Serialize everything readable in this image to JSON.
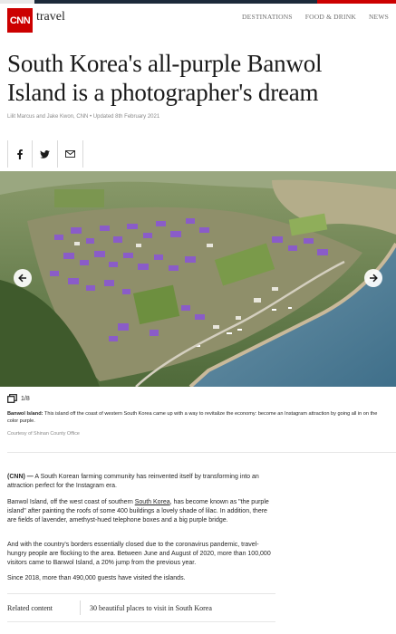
{
  "brand": {
    "logo_text": "CNN",
    "section": "travel",
    "colors": {
      "accent": "#cc0000",
      "dark": "#1c2a3a"
    }
  },
  "nav": {
    "items": [
      "DESTINATIONS",
      "FOOD & DRINK",
      "NEWS"
    ]
  },
  "article": {
    "headline_line1": "South Korea's all-purple Banwol",
    "headline_line2": "Island is a photographer's dream",
    "byline": "Lilit Marcus and Jake Kwon, CNN • Updated 8th February 2021"
  },
  "share": {
    "icons": [
      "facebook-icon",
      "twitter-icon",
      "email-icon"
    ]
  },
  "gallery": {
    "counter": "1/8",
    "caption_title": "Banwol Island:",
    "caption_text": " This island off the coast of western South Korea came up with a way to revitalize the economy: become an Instagram attraction by going all in on the color purple.",
    "credit": "Courtesy of Shinan County Office",
    "icons": [
      "arrow-left-icon",
      "arrow-right-icon",
      "gallery-icon"
    ]
  },
  "body": {
    "p1_dateline": "(CNN) —",
    "p1_text": " A South Korean farming community has reinvented itself by transforming into an attraction perfect for the Instagram era.",
    "p2_before": "Banwol Island, off the west coast of southern ",
    "p2_link": "South Korea",
    "p2_after": ", has become known as \"the purple island\" after painting the roofs of some 400 buildings a lovely shade of lilac. In addition, there are fields of lavender, amethyst-hued telephone boxes and a big purple bridge.",
    "p3": "And with the country's borders essentially closed due to the coronavirus pandemic, travel-hungry people are flocking to the area. Between June and August of 2020, more than 100,000 visitors came to Banwol Island, a 20% jump from the previous year.",
    "p4": "Since 2018, more than 490,000 guests have visited the islands."
  },
  "related": {
    "label": "Related content",
    "link": "30 beautiful places to visit in South Korea"
  }
}
